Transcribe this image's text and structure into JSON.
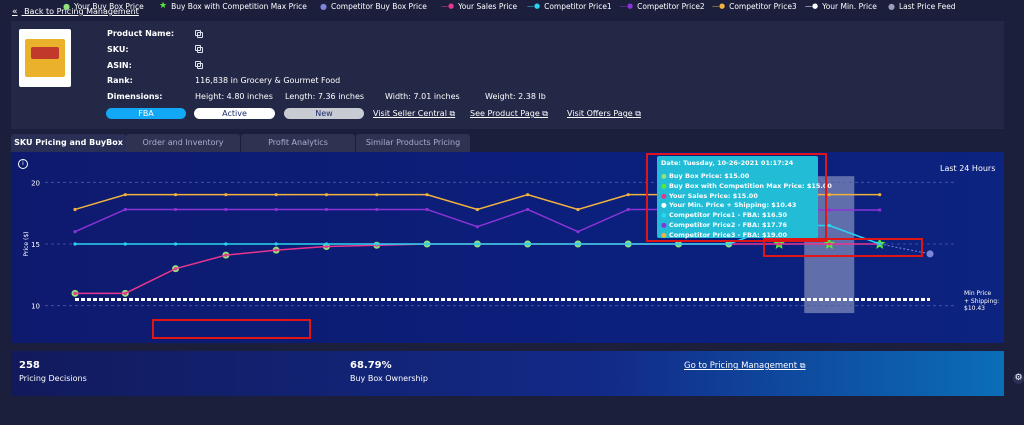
{
  "nav": {
    "back_label": "Back to Pricing Management"
  },
  "product": {
    "name_label": "Product Name:",
    "sku_label": "SKU:",
    "asin_label": "ASIN:",
    "rank_label": "Rank:",
    "rank_value": "116,838 in Grocery & Gourmet Food",
    "dimensions_label": "Dimensions:",
    "height": "Height: 4.80 inches",
    "length": "Length: 7.36 inches",
    "width": "Width: 7.01 inches",
    "weight": "Weight: 2.38 lb",
    "badge_fba": "FBA",
    "badge_active": "Active",
    "badge_new": "New",
    "link_seller": "Visit Seller Central",
    "link_product": "See Product Page",
    "link_offers": "Visit Offers Page"
  },
  "tabs": [
    {
      "label": "SKU Pricing and BuyBox",
      "active": true
    },
    {
      "label": "Order and Inventory",
      "active": false
    },
    {
      "label": "Profit Analytics",
      "active": false
    },
    {
      "label": "Similar Products Pricing",
      "active": false
    }
  ],
  "chart_data": {
    "type": "line",
    "title": "",
    "time_range_label": "Last 24 Hours",
    "ylabel": "Price ($)",
    "ylim": [
      9,
      21
    ],
    "yticks": [
      10,
      15,
      20
    ],
    "grid": true,
    "legend_position": "bottom",
    "series": [
      {
        "name": "Your Buy Box Price",
        "color": "#8fe37a",
        "marker": "circle",
        "values": [
          11,
          11,
          13,
          14.1,
          14.5,
          14.8,
          14.9,
          15,
          15,
          15,
          15,
          15,
          15,
          15,
          null,
          null,
          null,
          null
        ]
      },
      {
        "name": "Buy Box with Competition Max Price",
        "color": "#56e83c",
        "marker": "star",
        "values": [
          null,
          null,
          null,
          null,
          null,
          null,
          null,
          null,
          null,
          null,
          null,
          null,
          null,
          null,
          15,
          15,
          15,
          null
        ]
      },
      {
        "name": "Competitor Buy Box Price",
        "color": "#7d86d9",
        "marker": "circle",
        "values": [
          null,
          null,
          null,
          null,
          null,
          null,
          null,
          null,
          null,
          null,
          null,
          null,
          null,
          null,
          null,
          null,
          null,
          14.2
        ]
      },
      {
        "name": "Your Sales Price",
        "color": "#e8358f",
        "marker": "line",
        "values": [
          11,
          11,
          13,
          14.1,
          14.5,
          14.8,
          14.9,
          15,
          15,
          15,
          15,
          15,
          15,
          15,
          15,
          15,
          15,
          null
        ]
      },
      {
        "name": "Competitor Price1",
        "color": "#29d6f0",
        "marker": "line",
        "values": [
          15,
          15,
          15,
          15,
          15,
          15,
          15,
          15,
          15,
          15,
          15,
          15,
          15,
          15,
          16.5,
          16.5,
          15,
          null
        ]
      },
      {
        "name": "Competitor Price2",
        "color": "#8a33d6",
        "marker": "line",
        "values": [
          16,
          17.8,
          17.8,
          17.8,
          17.8,
          17.8,
          17.8,
          17.8,
          16.4,
          17.8,
          16,
          17.8,
          17.8,
          17.8,
          17.8,
          17.76,
          17.76,
          null
        ]
      },
      {
        "name": "Competitor Price3",
        "color": "#f2b23e",
        "marker": "line",
        "values": [
          17.8,
          19,
          19,
          19,
          19,
          19,
          19,
          19,
          17.8,
          19,
          17.8,
          19,
          19,
          19,
          19,
          19,
          19,
          null
        ]
      },
      {
        "name": "Your Min. Price",
        "color": "#ffffff",
        "marker": "dashed",
        "values": [
          10.5,
          10.5,
          10.5,
          10.5,
          10.5,
          10.5,
          10.5,
          10.5,
          10.5,
          10.5,
          10.5,
          10.5,
          10.5,
          10.5,
          10.5,
          10.5,
          10.5,
          10.5
        ]
      },
      {
        "name": "Last Price Feed",
        "color": "#9a9db4",
        "marker": "circle",
        "values": []
      }
    ],
    "tooltip": {
      "date": "Date: Tuesday, 10-26-2021 01:17:24",
      "rows": [
        "Buy Box Price: $15.00",
        "Buy Box with Competition Max Price: $15.00",
        "Your Sales Price: $15.00",
        "Your Min. Price + Shipping: $10.43",
        "Competitor Price1 - FBA: $16.50",
        "Competitor Price2 - FBA: $17.76",
        "Competitor Price3 - FBA: $19.00"
      ],
      "row_colors": [
        "#8fe37a",
        "#56e83c",
        "#e8358f",
        "#ffffff",
        "#29d6f0",
        "#8a33d6",
        "#f2b23e"
      ]
    },
    "min_price_annotation": [
      "Min Price",
      "+ Shipping:",
      "$10.43"
    ]
  },
  "stats": {
    "decisions_value": "258",
    "decisions_label": "Pricing Decisions",
    "ownership_value": "68.79%",
    "ownership_label": "Buy Box Ownership",
    "link_pricing": "Go to Pricing Management"
  },
  "colors": {
    "accent": "#0ea5ff",
    "highlight": "#e01515"
  }
}
